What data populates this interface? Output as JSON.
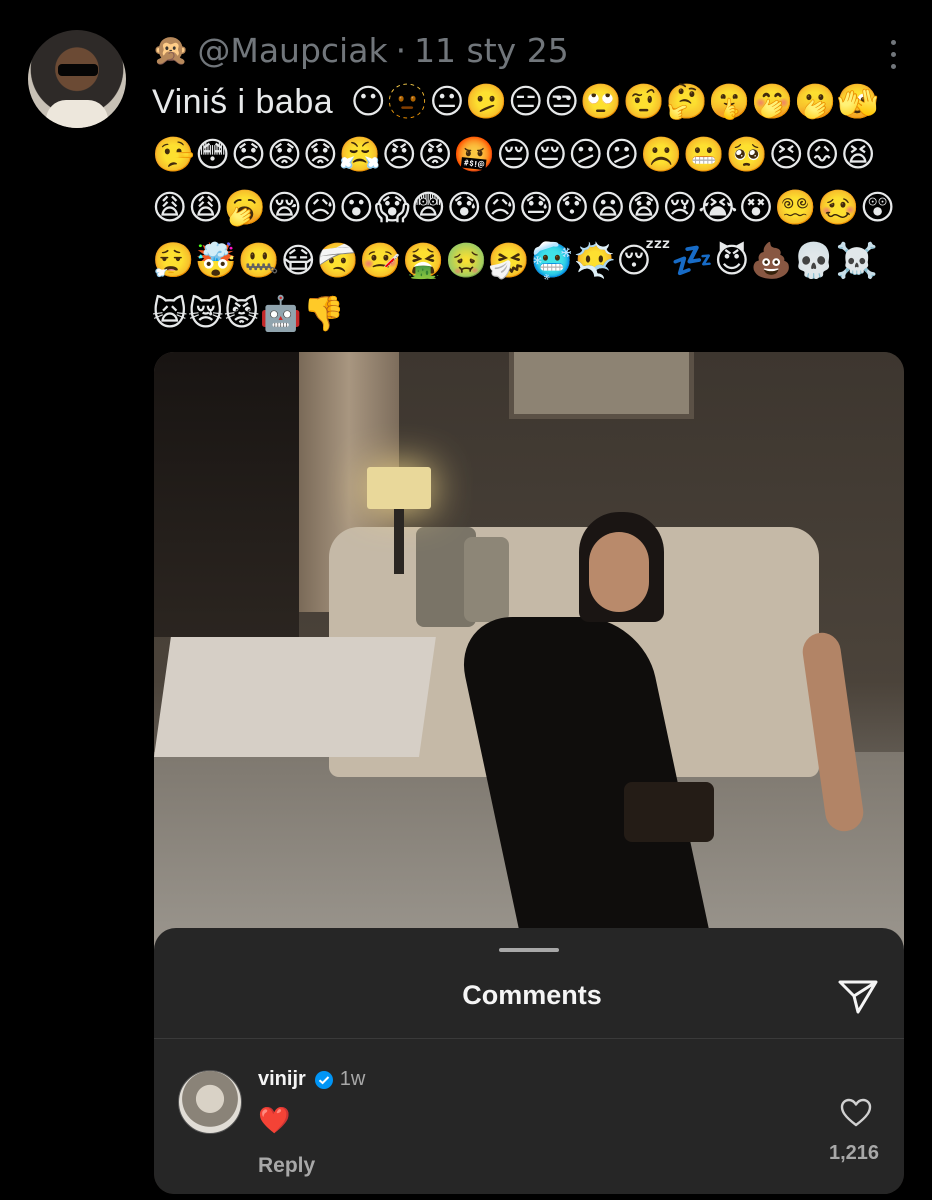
{
  "tweet": {
    "author_emoji": "🙊",
    "handle": "@Maupciak",
    "separator": "·",
    "date": "11 sty 25",
    "text_label": "Viniś i baba",
    "emojis": "😶🫥😐🫤😑😒🙄🤨🤔🤫🤭🫢🫣🤥😳😞😟😟😤😠😡🤬😔😔😕😕☹️😬🥺😣😖😫😩😩🥱😪😥😮😱😨😰😥😓😯😦😧😢😭😵😵‍💫🥴😲😮‍💨🤯🤐😷🤕🤒🤮🤢🤧🥶😶‍🌫️😴💤😈💩💀☠️🙀😿😾🤖👎"
  },
  "comments_sheet": {
    "title": "Comments",
    "comment": {
      "username": "vinijr",
      "time": "1w",
      "body": "❤️",
      "reply_label": "Reply",
      "like_count": "1,216"
    }
  },
  "icons": {
    "more": "more-dots-icon",
    "send": "send-icon",
    "verified": "verified-badge-icon",
    "like": "heart-outline-icon"
  },
  "colors": {
    "background": "#000000",
    "muted_text": "#71767b",
    "sheet_bg": "#262626",
    "verified": "#0095f6"
  }
}
